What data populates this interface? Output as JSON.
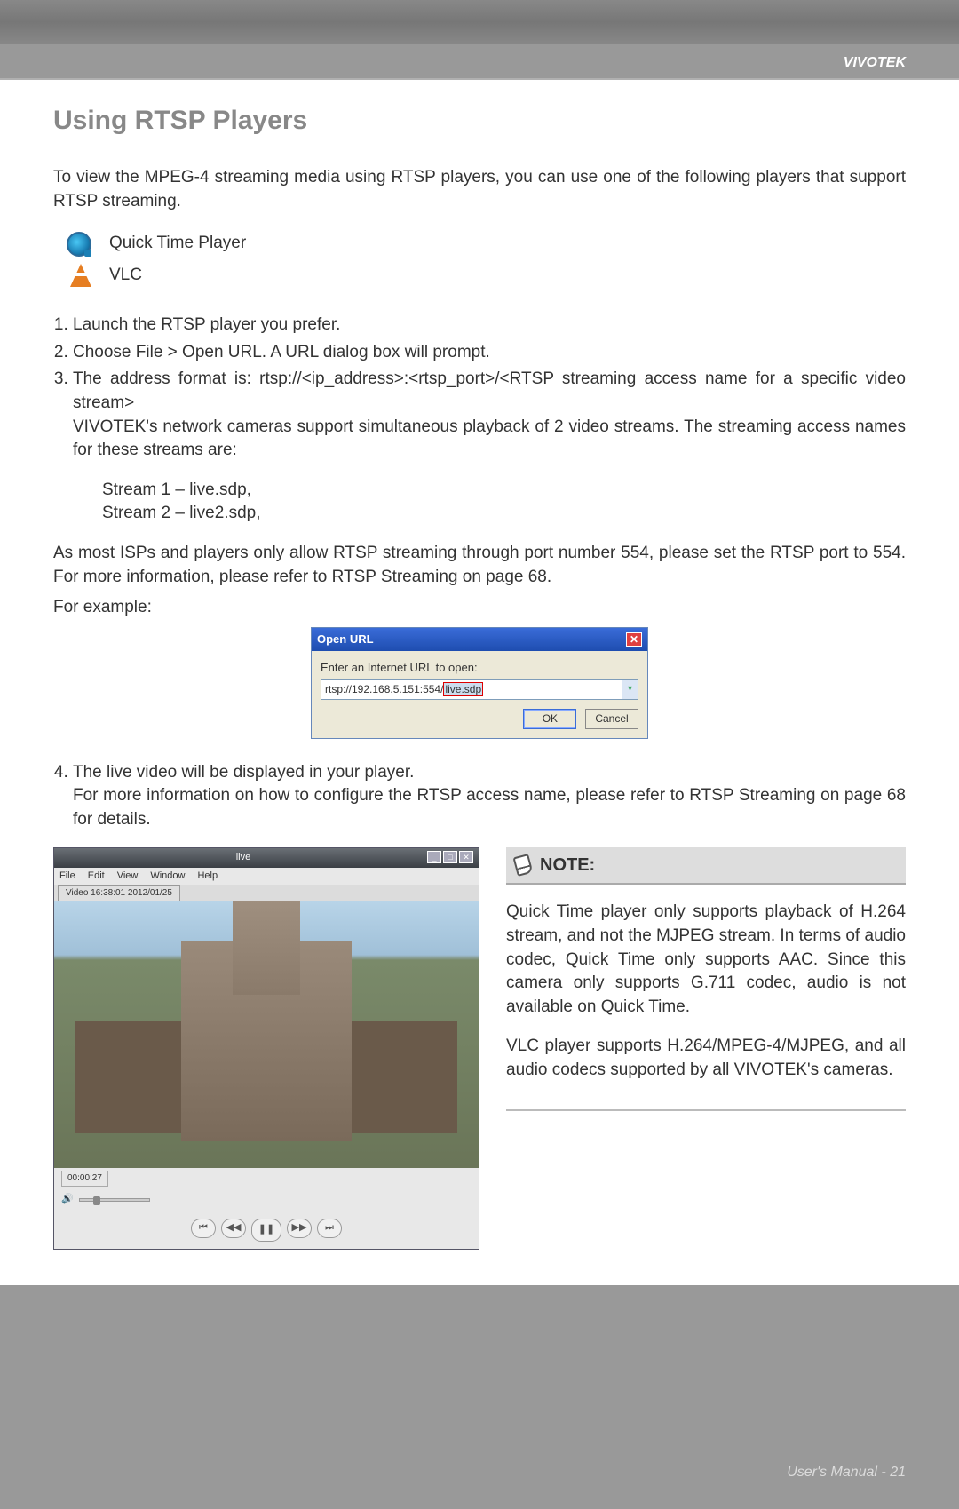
{
  "header": {
    "brand": "VIVOTEK"
  },
  "title": "Using RTSP Players",
  "intro": "To view the MPEG-4 streaming media using RTSP players, you can use one of the following players that support RTSP streaming.",
  "players": {
    "qt": "Quick Time Player",
    "vlc": "VLC"
  },
  "steps": {
    "s1": "Launch the RTSP player you prefer.",
    "s2": "Choose File > Open URL. A URL dialog box will prompt.",
    "s3a": "The address format is:  rtsp://<ip_address>:<rtsp_port>/<RTSP streaming access name for a specific video stream>",
    "s3b": "VIVOTEK's network cameras support simultaneous playback of 2 video streams. The streaming access names for these streams are:",
    "stream1": "Stream 1 – live.sdp,",
    "stream2": "Stream 2 – live2.sdp,",
    "isp": "As most ISPs and players only allow RTSP streaming through port number 554, please set the RTSP port to 554. For more information, please refer to RTSP Streaming on page 68.",
    "example_label": "For example:",
    "s4a": "The live video will be displayed in your player.",
    "s4b": "For more information on how to configure the RTSP access name, please refer to RTSP Streaming on page 68 for details."
  },
  "dialog": {
    "title": "Open URL",
    "label": "Enter an Internet URL to open:",
    "value_prefix": "rtsp://192.168.5.151:554/",
    "value_hl": "live.sdp",
    "ok": "OK",
    "cancel": "Cancel"
  },
  "player_window": {
    "title": "live",
    "menu": [
      "File",
      "Edit",
      "View",
      "Window",
      "Help"
    ],
    "tab": "Video 16:38:01 2012/01/25",
    "elapsed": "00:00:27",
    "controls": [
      "⏮",
      "◀◀",
      "❚❚",
      "▶▶",
      "⏭"
    ]
  },
  "note": {
    "heading": "NOTE:",
    "p1": "Quick Time player only supports playback of H.264 stream, and not the MJPEG stream. In terms of audio codec, Quick Time only supports AAC. Since this camera only supports G.711 codec, audio is not available on Quick Time.",
    "p2": "VLC player supports H.264/MPEG-4/MJPEG, and all audio codecs supported by all VIVOTEK's cameras."
  },
  "footer": {
    "label": "User's Manual - 21"
  }
}
